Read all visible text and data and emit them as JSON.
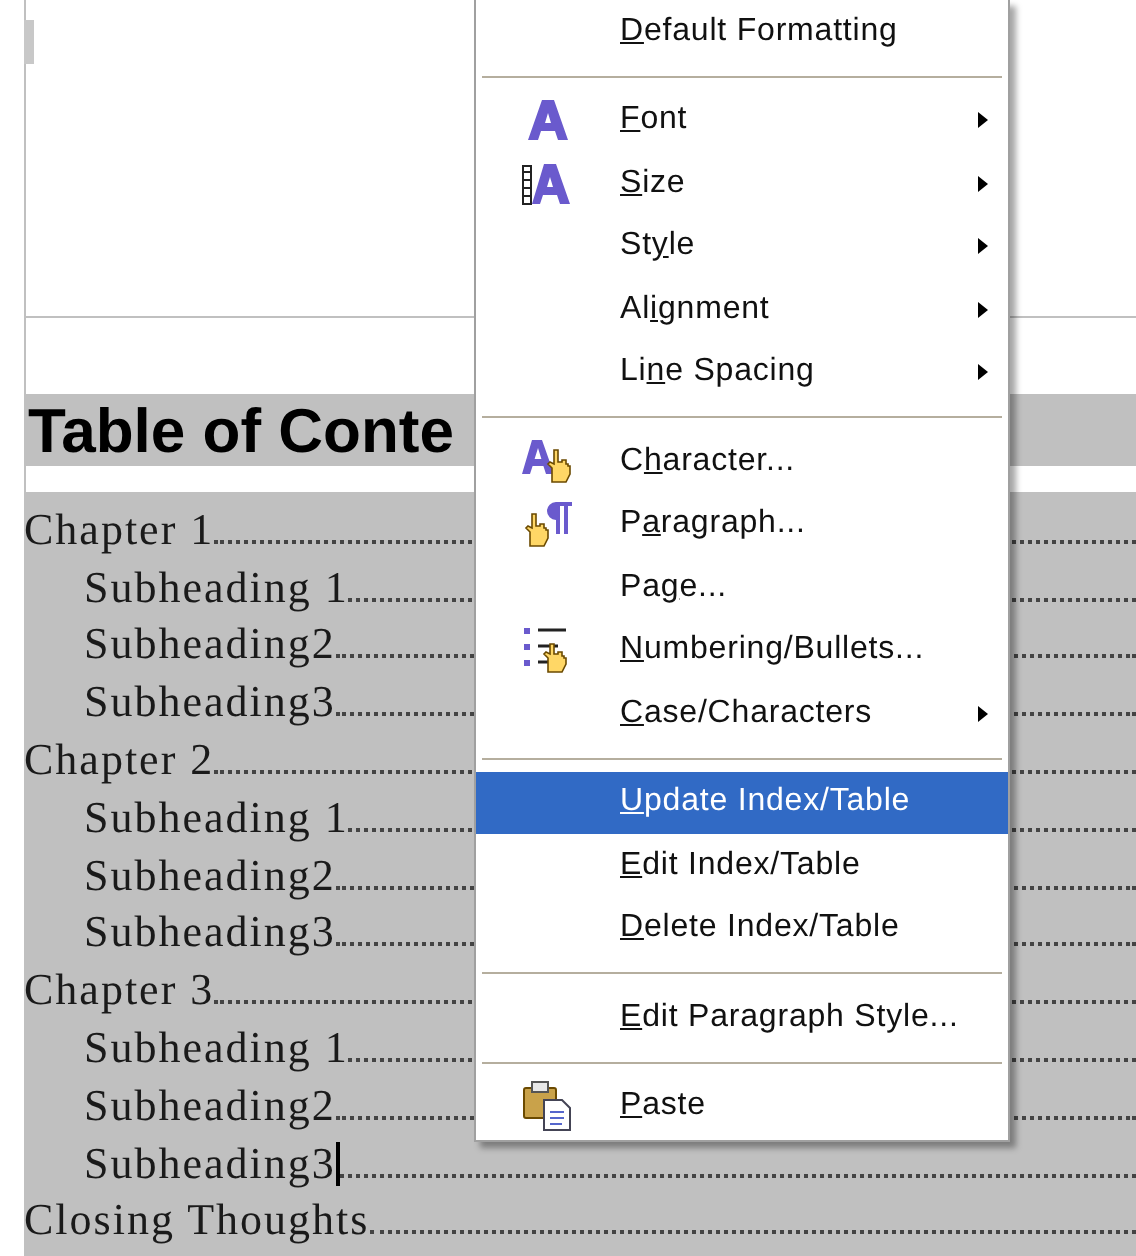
{
  "document": {
    "heading": "Table of Conte",
    "toc": [
      {
        "text": "Chapter 1",
        "kind": "chapter",
        "cursor": false
      },
      {
        "text": "Subheading 1",
        "kind": "sub",
        "cursor": false
      },
      {
        "text": "Subheading2",
        "kind": "sub",
        "cursor": false
      },
      {
        "text": "Subheading3",
        "kind": "sub",
        "cursor": false
      },
      {
        "text": "Chapter 2",
        "kind": "chapter",
        "cursor": false
      },
      {
        "text": "Subheading 1",
        "kind": "sub",
        "cursor": false
      },
      {
        "text": "Subheading2",
        "kind": "sub",
        "cursor": false
      },
      {
        "text": "Subheading3",
        "kind": "sub",
        "cursor": false
      },
      {
        "text": "Chapter 3",
        "kind": "chapter",
        "cursor": false
      },
      {
        "text": "Subheading 1",
        "kind": "sub",
        "cursor": false
      },
      {
        "text": "Subheading2",
        "kind": "sub",
        "cursor": false
      },
      {
        "text": "Subheading3",
        "kind": "sub",
        "cursor": true
      },
      {
        "text": "Closing Thoughts",
        "kind": "chapter",
        "cursor": false
      }
    ]
  },
  "context_menu": {
    "sections": [
      [
        {
          "key": "D",
          "post": "efault Formatting",
          "kind": "plain",
          "submenu": false,
          "selected": false
        }
      ],
      [
        {
          "key": "F",
          "post": "ont",
          "kind": "font",
          "submenu": true,
          "selected": false
        },
        {
          "key": "S",
          "post": "ize",
          "kind": "size",
          "submenu": true,
          "selected": false
        },
        {
          "pre": "St",
          "key": "y",
          "post": "le",
          "kind": "plain",
          "submenu": true,
          "selected": false
        },
        {
          "pre": "Al",
          "key": "i",
          "post": "gnment",
          "kind": "plain",
          "submenu": true,
          "selected": false
        },
        {
          "pre": "Li",
          "key": "n",
          "post": "e Spacing",
          "kind": "plain",
          "submenu": true,
          "selected": false
        }
      ],
      [
        {
          "pre": "C",
          "key": "h",
          "post": "aracter...",
          "kind": "character",
          "submenu": false,
          "selected": false
        },
        {
          "pre": "P",
          "key": "a",
          "post": "ragraph...",
          "kind": "paragraph",
          "submenu": false,
          "selected": false
        },
        {
          "pre": "Pa",
          "key": "g",
          "post": "e...",
          "kind": "plain",
          "submenu": false,
          "selected": false
        },
        {
          "key": "N",
          "post": "umbering/Bullets...",
          "kind": "numbering",
          "submenu": false,
          "selected": false
        },
        {
          "key": "C",
          "post": "ase/Characters",
          "kind": "plain",
          "submenu": true,
          "selected": false
        }
      ],
      [
        {
          "key": "U",
          "post": "pdate Index/Table",
          "kind": "plain",
          "submenu": false,
          "selected": true
        },
        {
          "key": "E",
          "post": "dit Index/Table",
          "kind": "plain",
          "submenu": false,
          "selected": false
        },
        {
          "key": "D",
          "post": "elete Index/Table",
          "kind": "plain",
          "submenu": false,
          "selected": false
        }
      ],
      [
        {
          "key": "E",
          "post": "dit Paragraph Style...",
          "kind": "plain",
          "submenu": false,
          "selected": false
        }
      ],
      [
        {
          "key": "P",
          "post": "aste",
          "kind": "paste",
          "submenu": false,
          "selected": false
        }
      ]
    ]
  }
}
